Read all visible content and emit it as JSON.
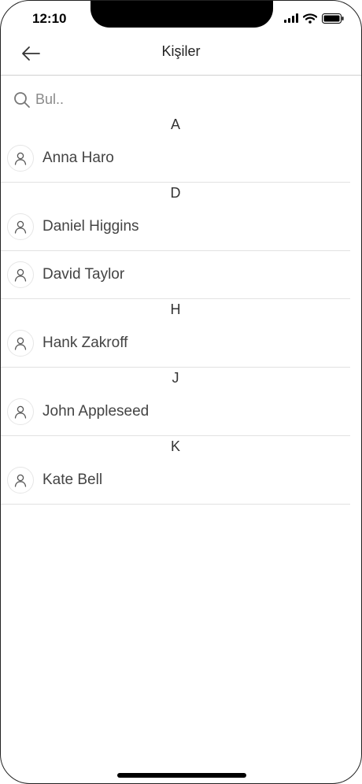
{
  "status_bar": {
    "time": "12:10"
  },
  "header": {
    "title": "Kişiler"
  },
  "search": {
    "placeholder": "Bul.."
  },
  "sections": [
    {
      "letter": "A",
      "contacts": [
        "Anna Haro"
      ]
    },
    {
      "letter": "D",
      "contacts": [
        "Daniel Higgins",
        "David Taylor"
      ]
    },
    {
      "letter": "H",
      "contacts": [
        "Hank Zakroff"
      ]
    },
    {
      "letter": "J",
      "contacts": [
        "John Appleseed"
      ]
    },
    {
      "letter": "K",
      "contacts": [
        "Kate Bell"
      ]
    }
  ],
  "icons": {
    "back": "arrow-left-icon",
    "search": "search-icon",
    "avatar": "person-icon"
  }
}
